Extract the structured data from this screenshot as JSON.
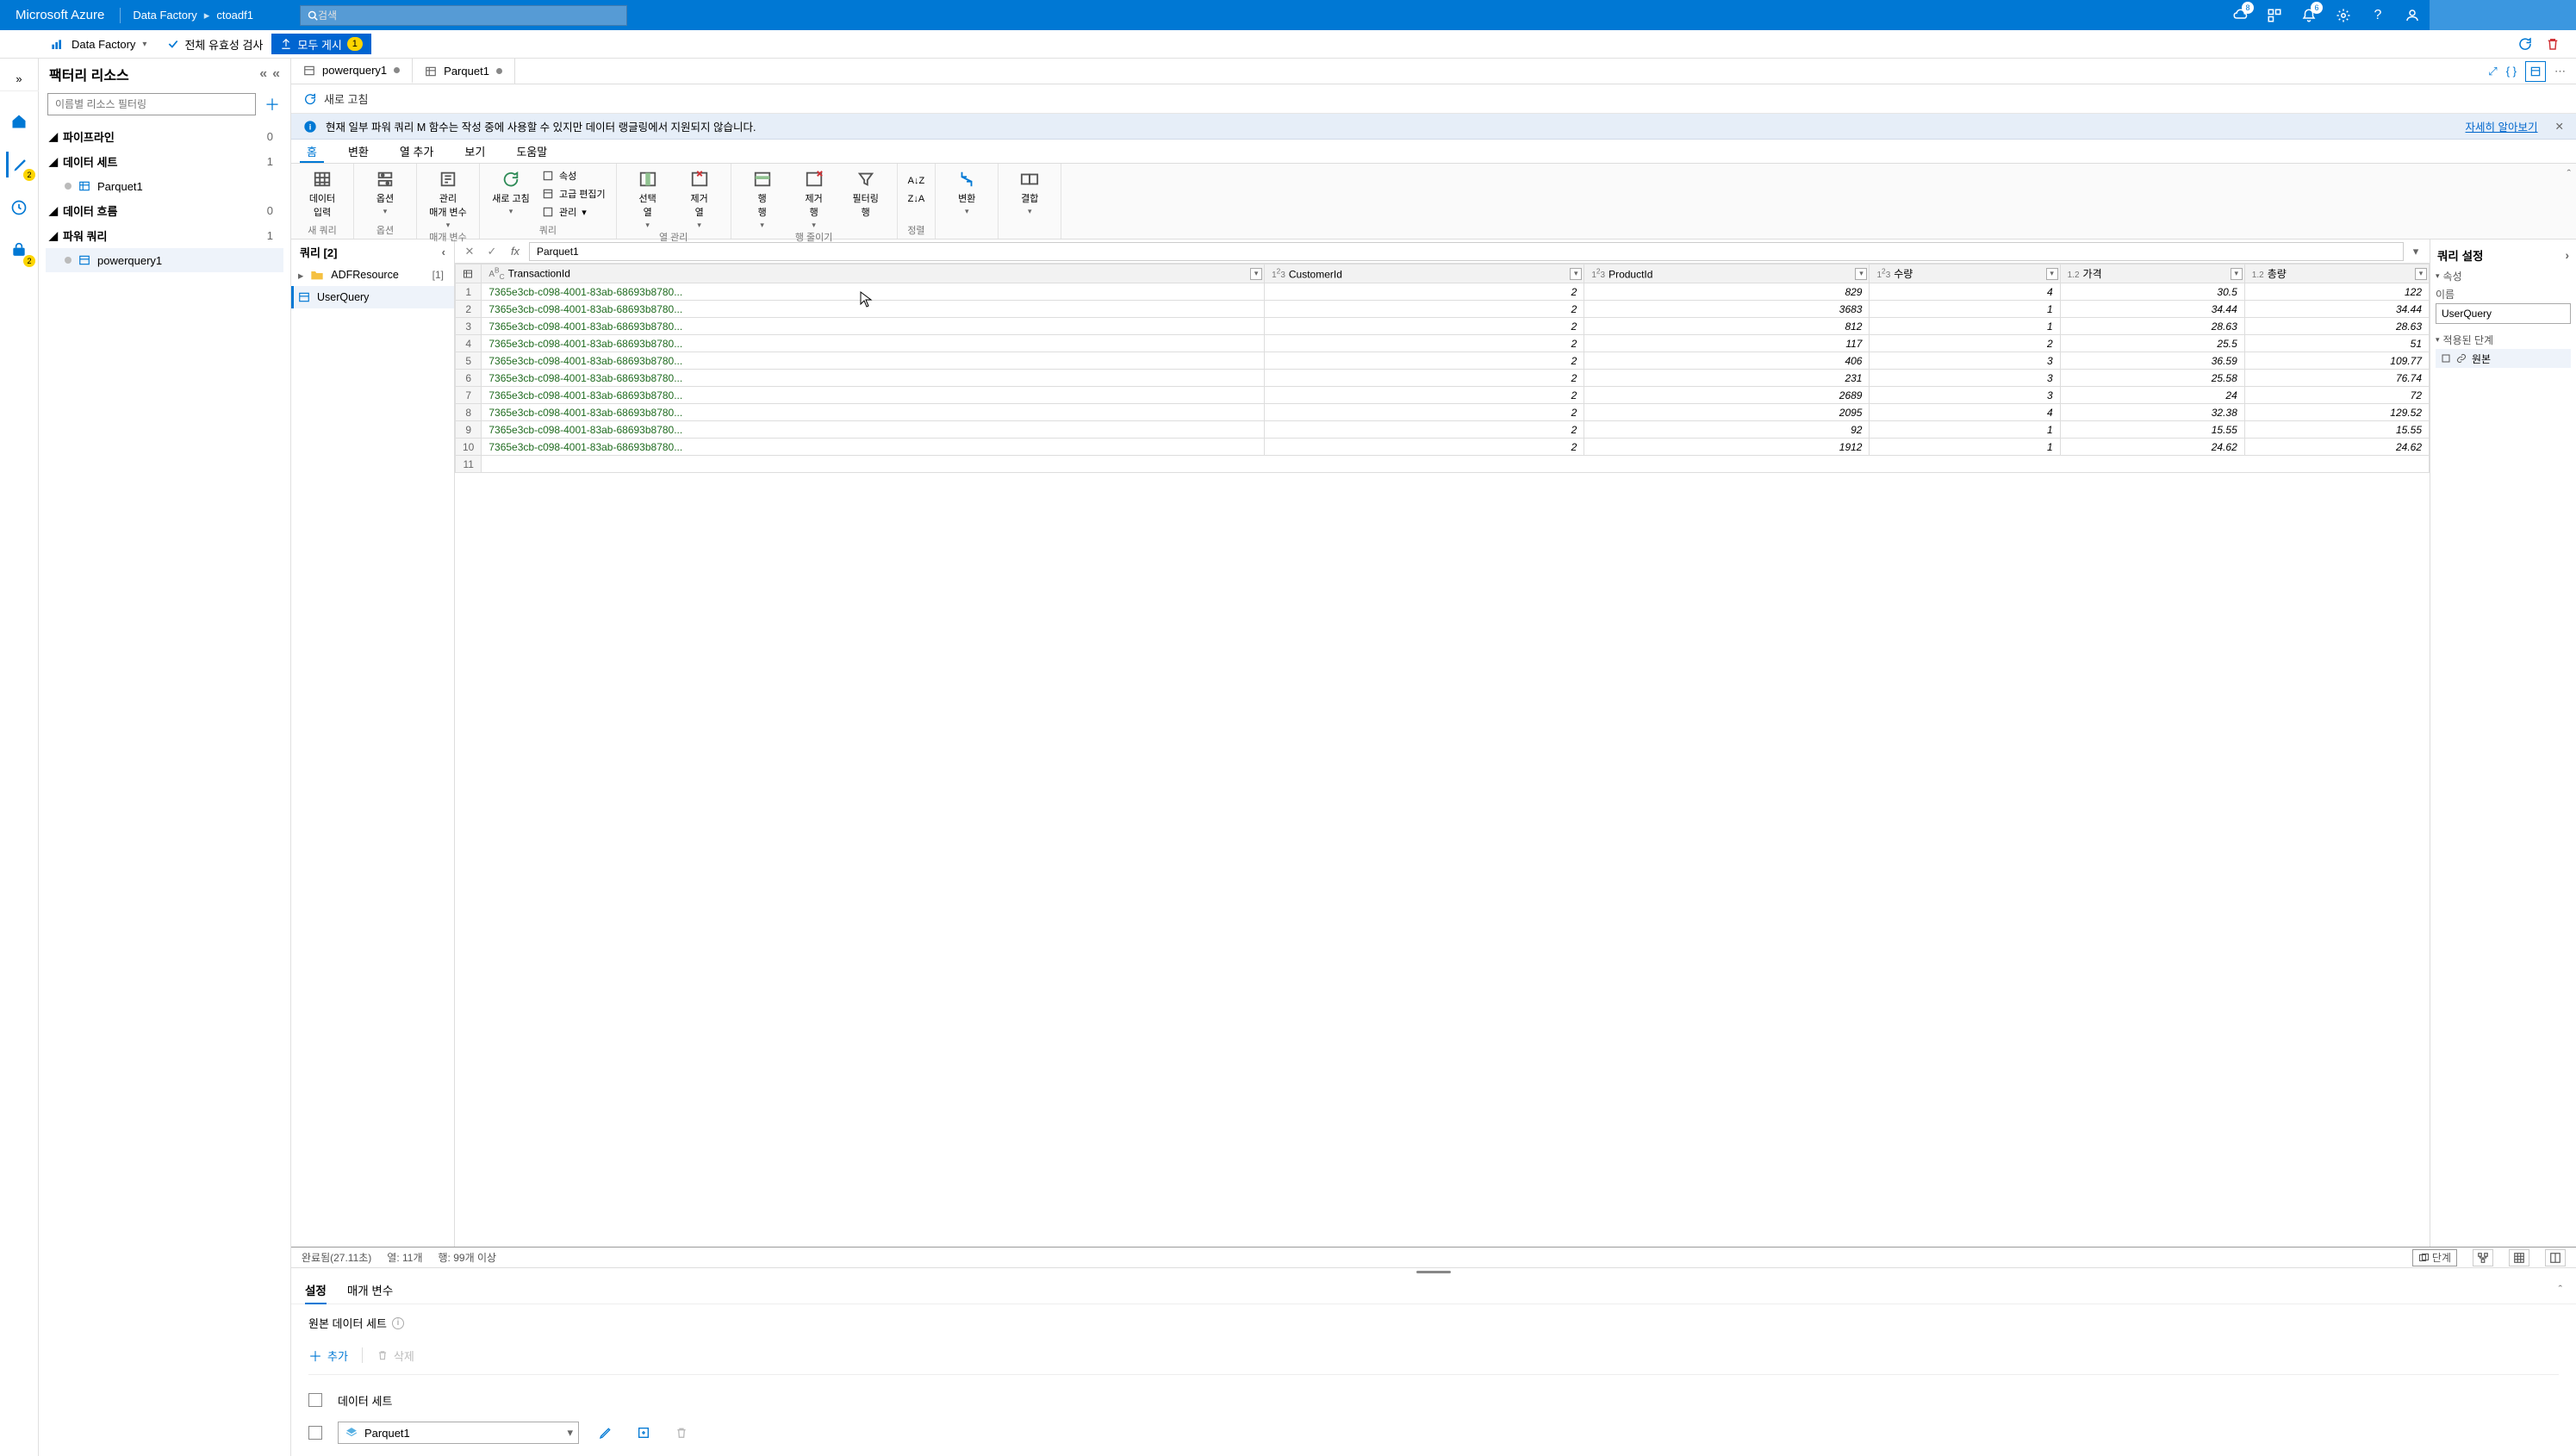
{
  "topbar": {
    "brand": "Microsoft Azure",
    "crumb1": "Data Factory",
    "crumb2": "ctoadf1",
    "search_placeholder": "검색",
    "badge_notify": "8",
    "badge_bell": "6"
  },
  "subbar": {
    "df_label": "Data Factory",
    "validate_label": "전체 유효성 검사",
    "publish_label": "모두 게시",
    "publish_count": "1"
  },
  "leftrail": {
    "pencil_badge": "2",
    "brief_badge": "2"
  },
  "factory": {
    "title": "팩터리 리소스",
    "filter_placeholder": "이름별 리소스 필터링",
    "sections": {
      "pipelines": {
        "label": "파이프라인",
        "count": "0"
      },
      "datasets": {
        "label": "데이터 세트",
        "count": "1",
        "child": "Parquet1"
      },
      "dataflows": {
        "label": "데이터 흐름",
        "count": "0"
      },
      "powerqueries": {
        "label": "파워 쿼리",
        "count": "1",
        "child": "powerquery1"
      }
    }
  },
  "tabs": {
    "t1": "powerquery1",
    "t2": "Parquet1"
  },
  "refresh": {
    "label": "새로 고침"
  },
  "info": {
    "msg": "현재 일부 파워 쿼리 M 함수는 작성 중에 사용할 수 있지만 데이터 랭글링에서 지원되지 않습니다.",
    "link": "자세히 알아보기"
  },
  "ribbon": {
    "tabs": {
      "home": "홈",
      "transform": "변환",
      "addcol": "열 추가",
      "view": "보기",
      "help": "도움말"
    },
    "groups": {
      "newquery": {
        "label": "새 쿼리",
        "b1": "데이터\n입력"
      },
      "options": {
        "label": "옵션",
        "b1": "옵션"
      },
      "params": {
        "label": "매개 변수",
        "b1": "관리\n매개 변수"
      },
      "query": {
        "label": "쿼리",
        "b1": "새로 고침",
        "m1": "속성",
        "m2": "고급 편집기",
        "m3": "관리"
      },
      "managecol": {
        "label": "열 관리",
        "b1": "선택\n열",
        "b2": "제거\n열"
      },
      "reducerows": {
        "label": "행 줄이기",
        "b1": "행\n행",
        "b2": "제거\n행",
        "b3": "필터링\n행"
      },
      "sort": {
        "label": "정렬"
      },
      "transform": {
        "b1": "변환"
      },
      "combine": {
        "b1": "결합"
      }
    }
  },
  "pq": {
    "queries_header": "쿼리 [2]",
    "folder": "ADFResource",
    "folder_count": "[1]",
    "userquery": "UserQuery",
    "fx_value": "Parquet1"
  },
  "columns": [
    "TransactionId",
    "CustomerId",
    "ProductId",
    "수량",
    "가격",
    "총량"
  ],
  "coltype": [
    "ABC",
    "123",
    "123",
    "123",
    "1.2",
    "1.2"
  ],
  "settings": {
    "title": "쿼리 설정",
    "props": "속성",
    "name_label": "이름",
    "name_value": "UserQuery",
    "steps_label": "적용된 단계",
    "step1": "원본"
  },
  "status": {
    "done": "완료됨(27.11초)",
    "cols": "열: 11개",
    "rows": "행: 99개 이상",
    "step_label": "단계"
  },
  "bottomtabs": {
    "settings": "설정",
    "params": "매개 변수"
  },
  "bottom": {
    "title": "원본 데이터 세트",
    "add": "추가",
    "delete": "삭제",
    "ds_header": "데이터 세트",
    "ds_value": "Parquet1"
  },
  "chart_data": {
    "type": "table",
    "columns": [
      "TransactionId",
      "CustomerId",
      "ProductId",
      "수량",
      "가격",
      "총량"
    ],
    "rows": [
      [
        "7365e3cb-c098-4001-83ab-68693b8780...",
        2,
        829,
        4,
        30.5,
        122
      ],
      [
        "7365e3cb-c098-4001-83ab-68693b8780...",
        2,
        3683,
        1,
        34.44,
        34.44
      ],
      [
        "7365e3cb-c098-4001-83ab-68693b8780...",
        2,
        812,
        1,
        28.63,
        28.63
      ],
      [
        "7365e3cb-c098-4001-83ab-68693b8780...",
        2,
        117,
        2,
        25.5,
        51
      ],
      [
        "7365e3cb-c098-4001-83ab-68693b8780...",
        2,
        406,
        3,
        36.59,
        109.77
      ],
      [
        "7365e3cb-c098-4001-83ab-68693b8780...",
        2,
        231,
        3,
        25.58,
        76.74
      ],
      [
        "7365e3cb-c098-4001-83ab-68693b8780...",
        2,
        2689,
        3,
        24,
        72
      ],
      [
        "7365e3cb-c098-4001-83ab-68693b8780...",
        2,
        2095,
        4,
        32.38,
        129.52
      ],
      [
        "7365e3cb-c098-4001-83ab-68693b8780...",
        2,
        92,
        1,
        15.55,
        15.55
      ],
      [
        "7365e3cb-c098-4001-83ab-68693b8780...",
        2,
        1912,
        1,
        24.62,
        24.62
      ]
    ]
  }
}
